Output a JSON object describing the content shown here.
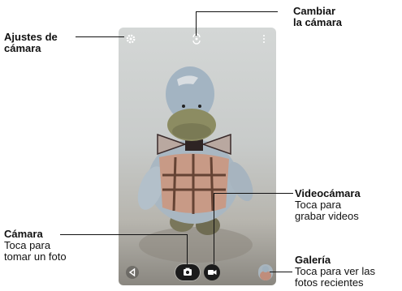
{
  "annotations": {
    "camera_settings": {
      "title_line1": "Ajustes de",
      "title_line2": "cámara"
    },
    "switch_camera": {
      "title_line1": "Cambiar",
      "title_line2": "la cámara"
    },
    "video_camera": {
      "title": "Videocámara",
      "desc_line1": "Toca para",
      "desc_line2": "grabar videos"
    },
    "camera": {
      "title": "Cámara",
      "desc_line1": "Toca para",
      "desc_line2": "tomar un foto"
    },
    "gallery": {
      "title": "Galería",
      "desc_line1": "Toca para ver las",
      "desc_line2": "fotos recientes"
    }
  },
  "icons": {
    "settings": "gear-icon",
    "switch_camera": "switch-camera-icon",
    "menu": "more-vert-icon",
    "back": "back-triangle-icon",
    "shutter": "camera-icon",
    "video": "video-camera-icon",
    "gallery": "gallery-thumbnail"
  }
}
